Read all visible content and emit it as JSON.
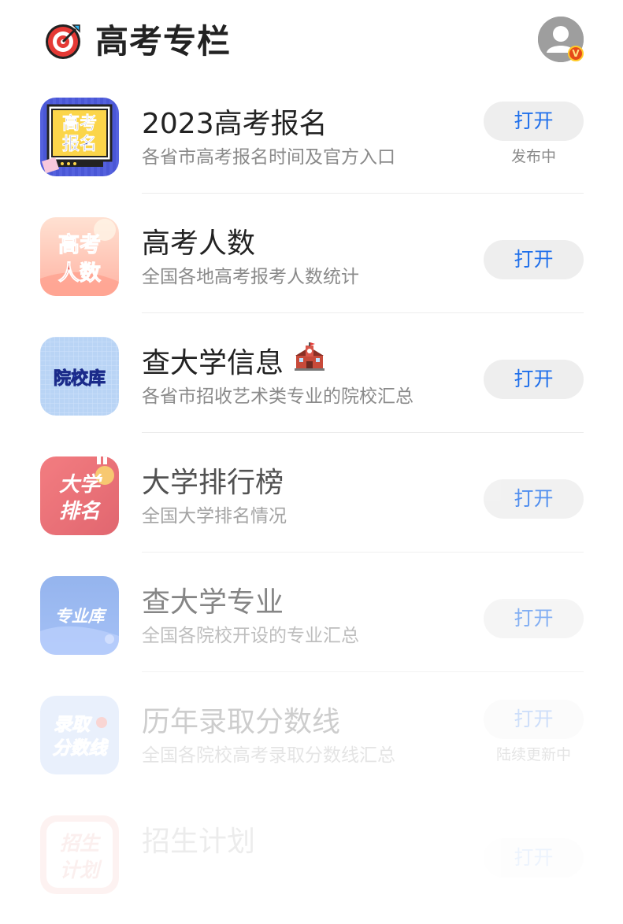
{
  "header": {
    "title": "高考专栏",
    "logo_icon": "target-icon",
    "avatar_icon": "user-avatar-icon",
    "badge_text": "V"
  },
  "items": [
    {
      "icon_text_1": "高考",
      "icon_text_2": "报名",
      "title": "2023高考报名",
      "desc": "各省市高考报名时间及官方入口",
      "button": "打开",
      "status": "发布中"
    },
    {
      "icon_text_1": "高考",
      "icon_text_2": "人数",
      "title": "高考人数",
      "desc": "全国各地高考报考人数统计",
      "button": "打开",
      "status": ""
    },
    {
      "icon_text_1": "院校库",
      "title": "查大学信息",
      "title_emoji": "school-emoji-icon",
      "desc": "各省市招收艺术类专业的院校汇总",
      "button": "打开",
      "status": ""
    },
    {
      "icon_text_1": "大学",
      "icon_text_2": "排名",
      "title": "大学排行榜",
      "desc": "全国大学排名情况",
      "button": "打开",
      "status": ""
    },
    {
      "icon_text_1": "专业库",
      "title": "查大学专业",
      "desc": "全国各院校开设的专业汇总",
      "button": "打开",
      "status": ""
    },
    {
      "icon_text_1": "录取",
      "icon_text_2": "分数线",
      "title": "历年录取分数线",
      "desc": "全国各院校高考录取分数线汇总",
      "button": "打开",
      "status": "陆续更新中"
    },
    {
      "icon_text_1": "招生",
      "icon_text_2": "计划",
      "title": "招生计划",
      "desc": "",
      "button": "打开",
      "status": ""
    }
  ],
  "colors": {
    "accent": "#1f6feb",
    "title": "#222222",
    "desc": "#8a8a8a",
    "button_bg": "#eeeeee"
  }
}
